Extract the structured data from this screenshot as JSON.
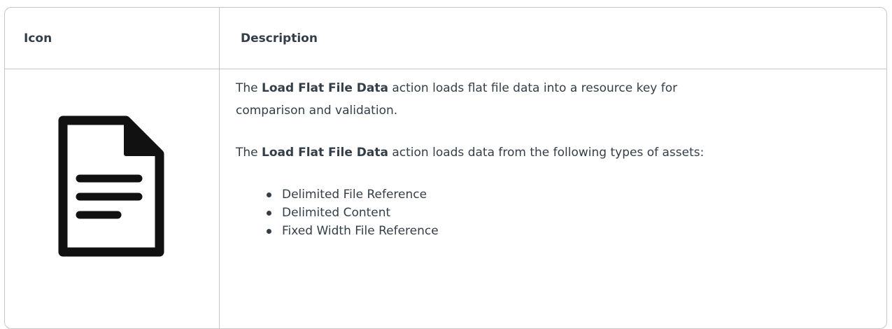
{
  "table": {
    "headers": {
      "icon": "Icon",
      "description": "Description"
    },
    "row": {
      "icon_name": "document-icon",
      "paragraph1": {
        "bold": "Load Flat File Data",
        "prefix": "The ",
        "suffix_line1": " action loads flat file data into a resource key for",
        "line2": "comparison and validation."
      },
      "paragraph2": {
        "prefix": "The ",
        "bold": "Load Flat File Data",
        "suffix": " action loads data from the following types of assets:"
      },
      "asset_types": [
        "Delimited File Reference",
        "Delimited Content",
        "Fixed Width File Reference"
      ]
    }
  },
  "colors": {
    "text": "#333e48",
    "border": "#c6c6c6",
    "icon": "#111111"
  }
}
